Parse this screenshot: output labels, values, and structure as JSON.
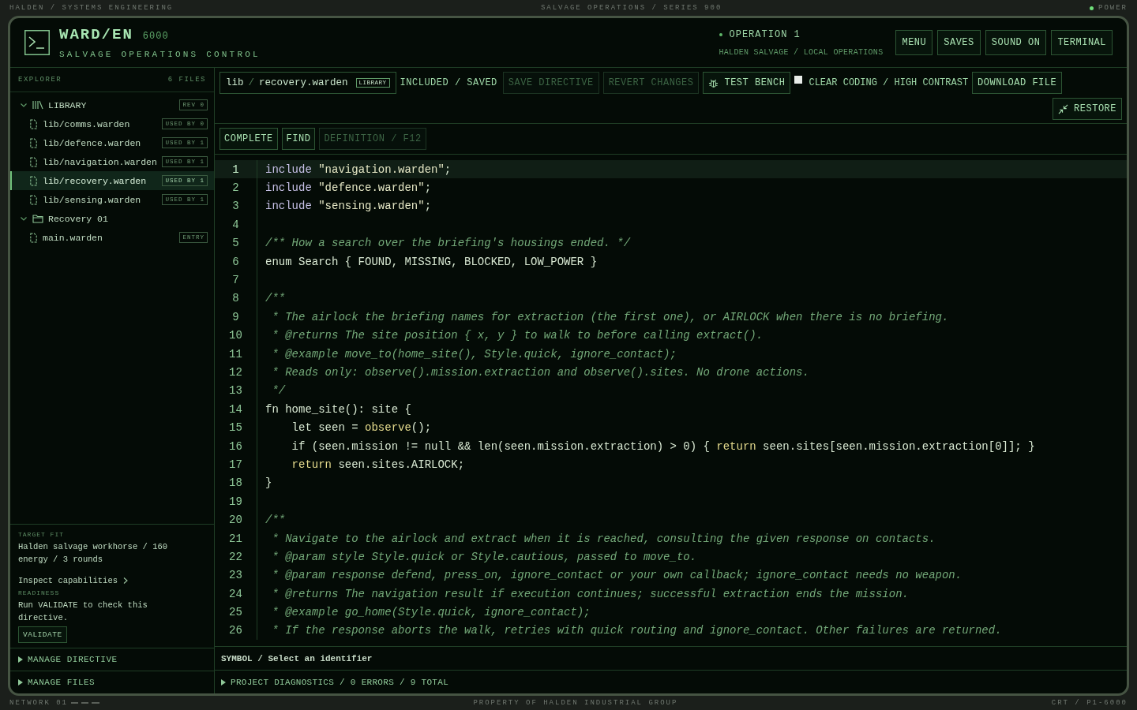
{
  "top_bar": {
    "left": "HALDEN / SYSTEMS ENGINEERING",
    "center": "SALVAGE OPERATIONS / SERIES 900",
    "power": {
      "label": "POWER",
      "color": "#6fe07a"
    }
  },
  "header": {
    "logo": "WARD/EN",
    "model": "6000",
    "subtitle": "SALVAGE OPERATIONS CONTROL",
    "operation": {
      "label": "OPERATION 1",
      "color": "#5fb86a"
    },
    "org": "HALDEN SALVAGE / LOCAL OPERATIONS",
    "buttons": [
      "MENU",
      "SAVES",
      "SOUND ON",
      "TERMINAL"
    ]
  },
  "explorer": {
    "title": "EXPLORER",
    "count": "6 FILES",
    "tree": [
      {
        "kind": "library",
        "label": "LIBRARY",
        "badge": "REV 0",
        "expanded": true,
        "children": [
          {
            "label": "lib/comms.warden",
            "badge": "USED BY 0",
            "selected": false
          },
          {
            "label": "lib/defence.warden",
            "badge": "USED BY 1",
            "selected": false
          },
          {
            "label": "lib/navigation.warden",
            "badge": "USED BY 1",
            "selected": false
          },
          {
            "label": "lib/recovery.warden",
            "badge": "USED BY 1",
            "selected": true
          },
          {
            "label": "lib/sensing.warden",
            "badge": "USED BY 1",
            "selected": false
          }
        ]
      },
      {
        "kind": "folder",
        "label": "Recovery 01",
        "expanded": true,
        "children": [
          {
            "label": "main.warden",
            "badge": "ENTRY",
            "selected": false
          }
        ]
      }
    ]
  },
  "target_fit": {
    "label": "TARGET FIT",
    "text": "Halden salvage workhorse / 160 energy / 3 rounds",
    "link": "Inspect capabilities",
    "readiness_label": "READINESS",
    "readiness_text": "Run VALIDATE to check this directive.",
    "button": "VALIDATE"
  },
  "sections": [
    {
      "label": "MANAGE DIRECTIVE",
      "expanded": false
    },
    {
      "label": "MANAGE FILES",
      "expanded": false
    }
  ],
  "toolbar": {
    "path_dir": "lib",
    "path_sep": "/",
    "file": "recovery.warden",
    "badge": "LIBRARY",
    "status": "INCLUDED / SAVED",
    "buttons": [
      {
        "label": "SAVE DIRECTIVE",
        "kind": "plain",
        "disabled": true
      },
      {
        "label": "REVERT CHANGES",
        "kind": "plain",
        "disabled": true
      },
      {
        "label": "TEST BENCH",
        "kind": "bug",
        "disabled": false
      }
    ],
    "contrast": {
      "label": "CLEAR CODING / HIGH CONTRAST",
      "checked": false
    },
    "download": "DOWNLOAD FILE",
    "restore": "RESTORE"
  },
  "assist": [
    {
      "label": "COMPLETE",
      "disabled": false
    },
    {
      "label": "FIND",
      "disabled": false
    },
    {
      "label": "DEFINITION / F12",
      "disabled": true
    }
  ],
  "code": [
    {
      "n": "1",
      "current": true,
      "segments": [
        {
          "kind": "keyword",
          "text": "include "
        },
        {
          "kind": "string",
          "text": "\"navigation.warden\""
        },
        {
          "kind": "text",
          "text": ";"
        }
      ]
    },
    {
      "n": "2",
      "current": false,
      "segments": [
        {
          "kind": "keyword",
          "text": "include "
        },
        {
          "kind": "string",
          "text": "\"defence.warden\""
        },
        {
          "kind": "text",
          "text": ";"
        }
      ]
    },
    {
      "n": "3",
      "current": false,
      "segments": [
        {
          "kind": "keyword",
          "text": "include "
        },
        {
          "kind": "string",
          "text": "\"sensing.warden\""
        },
        {
          "kind": "text",
          "text": ";"
        }
      ]
    },
    {
      "n": "4",
      "current": false
    },
    {
      "n": "5",
      "current": false,
      "segments": [
        {
          "kind": "comment",
          "text": "/** How a search over the briefing's housings ended. */"
        }
      ]
    },
    {
      "n": "6",
      "current": false,
      "segments": [
        {
          "kind": "text",
          "text": "enum Search { FOUND, MISSING, BLOCKED, LOW_POWER }"
        }
      ]
    },
    {
      "n": "7",
      "current": false
    },
    {
      "n": "8",
      "current": false,
      "segments": [
        {
          "kind": "comment",
          "text": "/**"
        }
      ]
    },
    {
      "n": "9",
      "current": false,
      "segments": [
        {
          "kind": "comment",
          "text": " * The airlock the briefing names for extraction (the first one), or AIRLOCK when there is no briefing."
        }
      ]
    },
    {
      "n": "10",
      "current": false,
      "segments": [
        {
          "kind": "comment",
          "text": " * @returns The site position { x, y } to walk to before calling extract()."
        }
      ]
    },
    {
      "n": "11",
      "current": false,
      "segments": [
        {
          "kind": "comment",
          "text": " * @example move_to(home_site(), Style.quick, ignore_contact);"
        }
      ]
    },
    {
      "n": "12",
      "current": false,
      "segments": [
        {
          "kind": "comment",
          "text": " * Reads only: observe().mission.extraction and observe().sites. No drone actions."
        }
      ]
    },
    {
      "n": "13",
      "current": false,
      "segments": [
        {
          "kind": "comment",
          "text": " */"
        }
      ]
    },
    {
      "n": "14",
      "current": false,
      "segments": [
        {
          "kind": "text",
          "text": "fn home_site(): site {"
        }
      ]
    },
    {
      "n": "15",
      "current": false,
      "segments": [
        {
          "kind": "text",
          "text": "    let seen = "
        },
        {
          "kind": "call",
          "text": "observe"
        },
        {
          "kind": "text",
          "text": "();"
        }
      ]
    },
    {
      "n": "16",
      "current": false,
      "segments": [
        {
          "kind": "text",
          "text": "    if (seen.mission != null && len(seen.mission.extraction) > 0) { "
        },
        {
          "kind": "control",
          "text": "return"
        },
        {
          "kind": "text",
          "text": " seen.sites[seen.mission.extraction[0]]; }"
        }
      ]
    },
    {
      "n": "17",
      "current": false,
      "segments": [
        {
          "kind": "control",
          "text": "    return"
        },
        {
          "kind": "text",
          "text": " seen.sites.AIRLOCK;"
        }
      ]
    },
    {
      "n": "18",
      "current": false,
      "segments": [
        {
          "kind": "text",
          "text": "}"
        }
      ]
    },
    {
      "n": "19",
      "current": false
    },
    {
      "n": "20",
      "current": false,
      "segments": [
        {
          "kind": "comment",
          "text": "/**"
        }
      ]
    },
    {
      "n": "21",
      "current": false,
      "segments": [
        {
          "kind": "comment",
          "text": " * Navigate to the airlock and extract when it is reached, consulting the given response on contacts."
        }
      ]
    },
    {
      "n": "22",
      "current": false,
      "segments": [
        {
          "kind": "comment",
          "text": " * @param style Style.quick or Style.cautious, passed to move_to."
        }
      ]
    },
    {
      "n": "23",
      "current": false,
      "segments": [
        {
          "kind": "comment",
          "text": " * @param response defend, press_on, ignore_contact or your own callback; ignore_contact needs no weapon."
        }
      ]
    },
    {
      "n": "24",
      "current": false,
      "segments": [
        {
          "kind": "comment",
          "text": " * @returns The navigation result if execution continues; successful extraction ends the mission."
        }
      ]
    },
    {
      "n": "25",
      "current": false,
      "segments": [
        {
          "kind": "comment",
          "text": " * @example go_home(Style.quick, ignore_contact);"
        }
      ]
    },
    {
      "n": "26",
      "current": false,
      "segments": [
        {
          "kind": "comment",
          "text": " * If the response aborts the walk, retries with quick routing and ignore_contact. Other failures are returned."
        }
      ]
    }
  ],
  "symbol_bar": "SYMBOL / Select an identifier",
  "diagnostics": {
    "label": "PROJECT DIAGNOSTICS / 0 ERRORS / 9 TOTAL",
    "expanded": false
  },
  "bottom_bar": {
    "left": "NETWORK 01",
    "center": "PROPERTY OF HALDEN INDUSTRIAL GROUP",
    "right": "CRT / P1-6000"
  }
}
